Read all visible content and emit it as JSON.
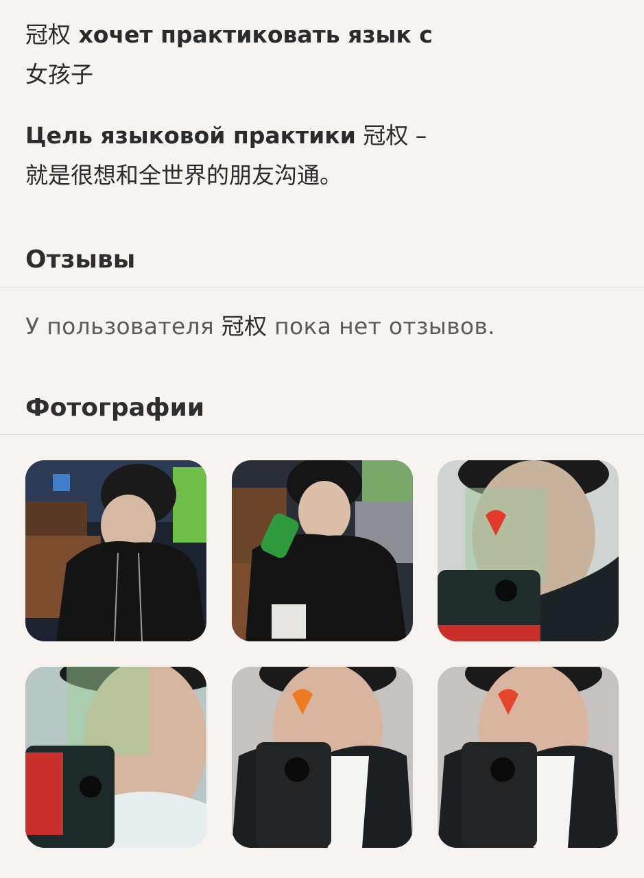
{
  "about": {
    "line1_name": "冠权",
    "line1_text": " хочет практиковать язык с",
    "line2_text": "女孩子",
    "goal_label": "Цель языковой практики",
    "goal_name": " 冠权 –",
    "goal_text": "就是很想和全世界的朋友沟通。"
  },
  "reviews": {
    "heading": "Отзывы",
    "empty_prefix": "У пользователя ",
    "empty_name": "冠权",
    "empty_suffix": " пока нет отзывов."
  },
  "photos": {
    "heading": "Фотографии",
    "count": 6
  },
  "colors": {
    "background": "#f6f3f1",
    "text": "#2b2b2b",
    "divider": "#e2dedb"
  }
}
